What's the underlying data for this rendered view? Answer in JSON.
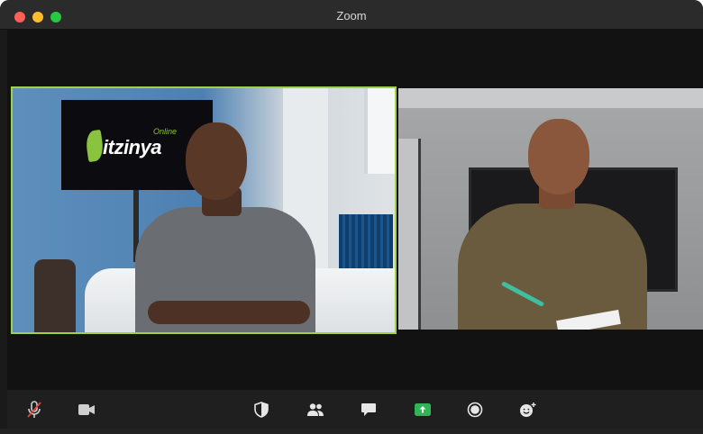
{
  "window": {
    "title": "Zoom",
    "traffic_lights": {
      "close": "#fe5f57",
      "minimize": "#febc2e",
      "maximize": "#28c840"
    }
  },
  "participants": [
    {
      "active_speaker": true,
      "highlight_color": "#9fd24a",
      "background_logo": {
        "name": "itzinya",
        "tagline": "Online",
        "i_glyph": "i",
        "brand_color": "#8ac43f"
      }
    },
    {
      "active_speaker": false
    }
  ],
  "toolbar": {
    "buttons": [
      {
        "icon": "microphone-muted-icon"
      },
      {
        "icon": "video-camera-icon"
      },
      {
        "icon": "shield-icon"
      },
      {
        "icon": "participants-icon"
      },
      {
        "icon": "chat-bubble-icon"
      },
      {
        "icon": "share-screen-icon",
        "accent": "#2fb457"
      },
      {
        "icon": "record-icon"
      },
      {
        "icon": "reactions-icon"
      }
    ]
  }
}
